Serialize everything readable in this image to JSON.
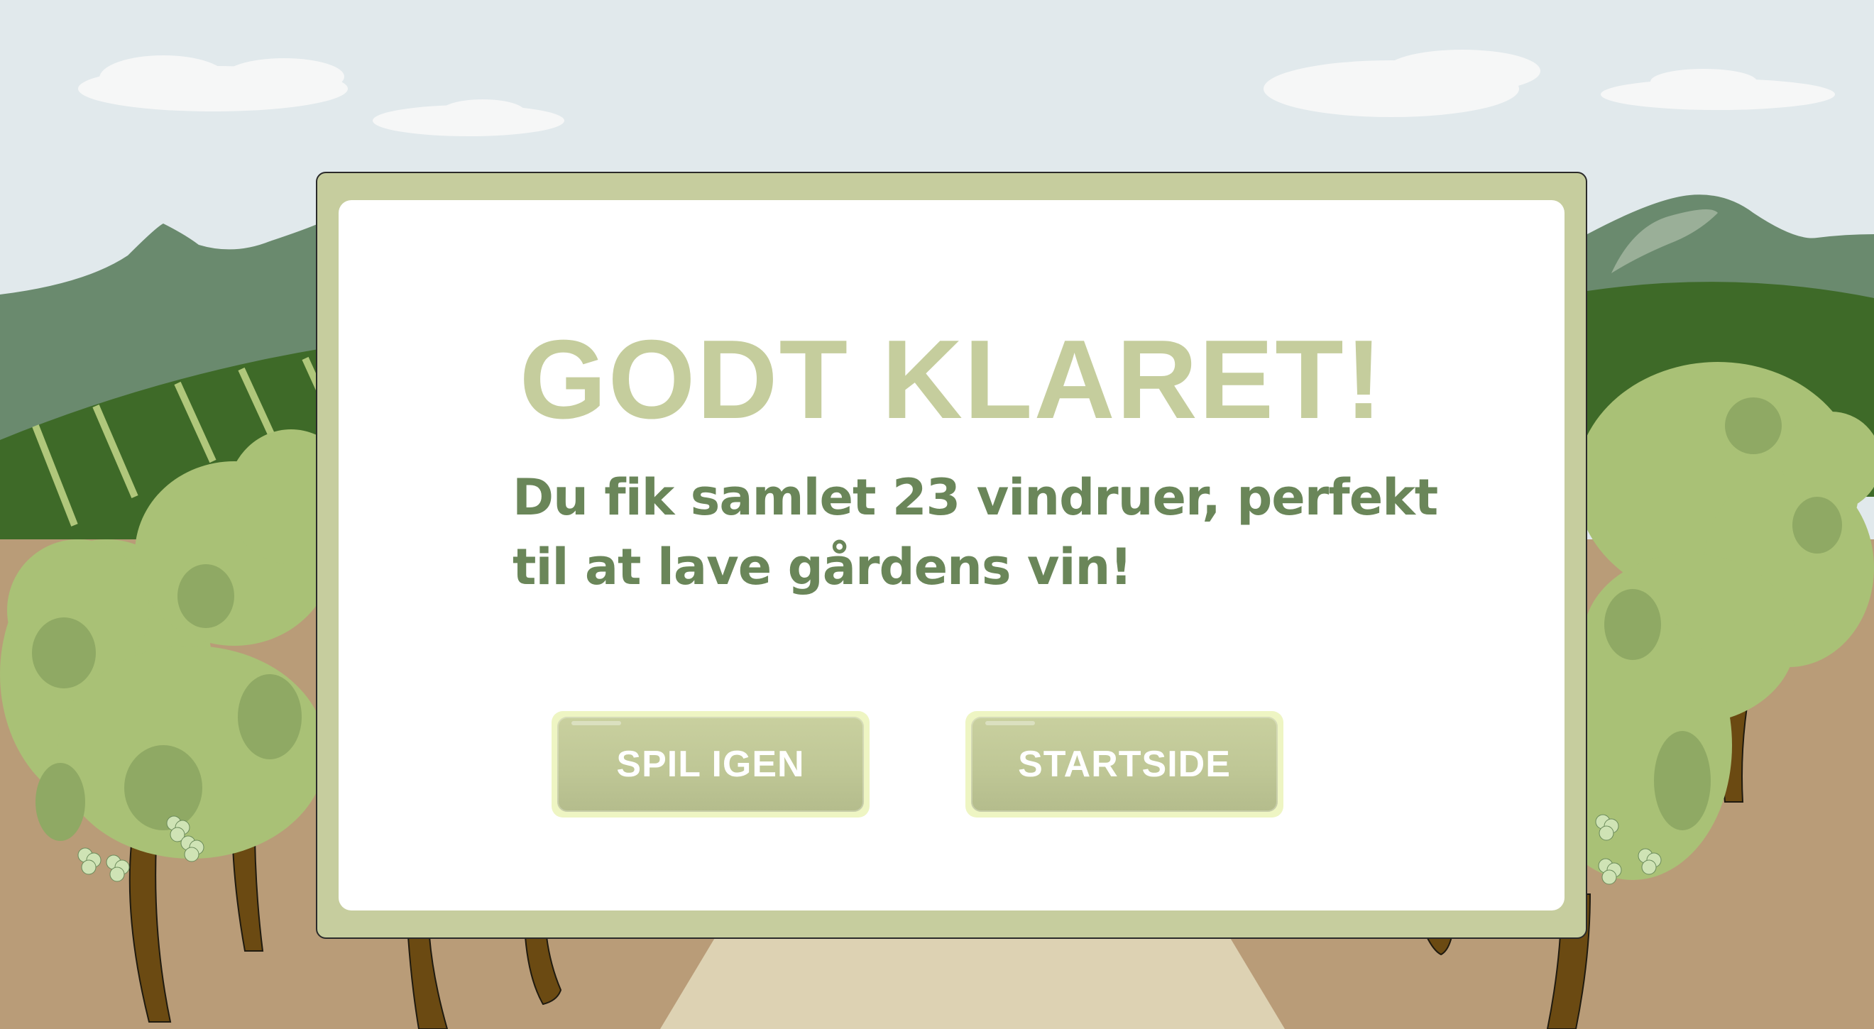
{
  "modal": {
    "title": "GODT KLARET!",
    "message": "Du fik samlet 23 vindruer, perfekt til at lave gårdens vin!"
  },
  "buttons": {
    "play_again": "SPIL IGEN",
    "home": "STARTSIDE"
  },
  "colors": {
    "sky": "#e1e9ec",
    "mountain": "#6a8a6e",
    "field": "#3e6a28",
    "ground": "#b99c78",
    "path": "#ddd2b3",
    "tree_foliage": "#a9c176",
    "tree_trunk": "#6b4a12",
    "modal_frame": "#c6cd9e",
    "title_text": "#c5cd9d",
    "message_text": "#6a8659",
    "button": "#c1c896"
  }
}
